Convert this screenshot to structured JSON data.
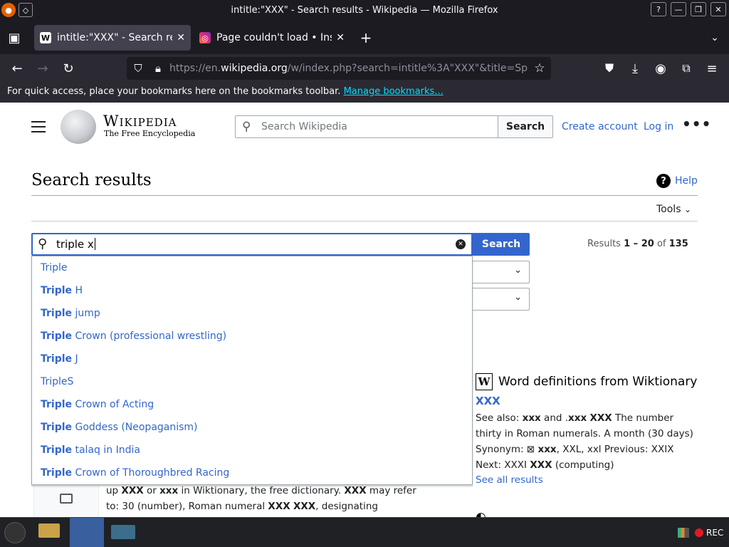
{
  "window": {
    "title": "intitle:\"XXX\" - Search results - Wikipedia — Mozilla Firefox",
    "wm_icons": [
      "minimize-icon",
      "maximize-icon",
      "close-icon"
    ]
  },
  "tabs": [
    {
      "label": "intitle:\"XXX\" - Search res",
      "favicon": "W",
      "active": true
    },
    {
      "label": "Page couldn't load • Inst",
      "favicon": "◎",
      "active": false
    }
  ],
  "navbar": {
    "url_prefix": "https://en.",
    "url_domain": "wikipedia.org",
    "url_suffix": "/w/index.php?search=intitle%3A\"XXX\"&title=Sp"
  },
  "bookmarks_bar": {
    "text": "For quick access, place your bookmarks here on the bookmarks toolbar.",
    "link": "Manage bookmarks..."
  },
  "header": {
    "wordmark": "Wikipedia",
    "tagline": "The Free Encyclopedia",
    "search_placeholder": "Search Wikipedia",
    "search_button": "Search",
    "create_account": "Create account",
    "login": "Log in",
    "more": "•••"
  },
  "main": {
    "title": "Search results",
    "help": "Help",
    "tools": "Tools",
    "search_value": "triple x",
    "search_button": "Search",
    "results_prefix": "Results",
    "results_range": "1 – 20",
    "results_of": "of",
    "results_total": "135"
  },
  "suggestions": [
    {
      "bold": "",
      "rest": "Triple"
    },
    {
      "bold": "Triple",
      "rest": " H"
    },
    {
      "bold": "Triple",
      "rest": " jump"
    },
    {
      "bold": "Triple",
      "rest": " Crown (professional wrestling)"
    },
    {
      "bold": "Triple",
      "rest": " J"
    },
    {
      "bold": "",
      "rest": "TripleS"
    },
    {
      "bold": "Triple",
      "rest": " Crown of Acting"
    },
    {
      "bold": "Triple",
      "rest": " Goddess (Neopaganism)"
    },
    {
      "bold": "Triple",
      "rest": " talaq in India"
    },
    {
      "bold": "Triple",
      "rest": " Crown of Thoroughbred Racing"
    }
  ],
  "wiktionary": {
    "heading": "Word definitions from Wiktionary",
    "logo": "W",
    "term": "XXX",
    "def_parts": [
      "See also: ",
      "xxx",
      " and .",
      "xxx",
      " ",
      "XXX",
      " The number thirty in Roman numerals. A month (30 days) Synonym: ⊠ ",
      "xxx",
      ", XXL, xxl Previous: XXIX Next: XXXI ",
      "XXX",
      " (computing)"
    ],
    "see_all": "See all results"
  },
  "snippet": {
    "parts": [
      "up ",
      "XXX",
      " or ",
      "xxx",
      " in Wiktionary, the free dictionary. ",
      "XXX",
      " may refer to: 30 (number), Roman numeral ",
      "XXX",
      " ",
      "XXX",
      ", designating"
    ]
  },
  "taskbar": {
    "rec": "REC"
  },
  "colors": {
    "accent": "#3366cc",
    "link": "#3366cc",
    "chrome_dark": "#1c1b22"
  }
}
